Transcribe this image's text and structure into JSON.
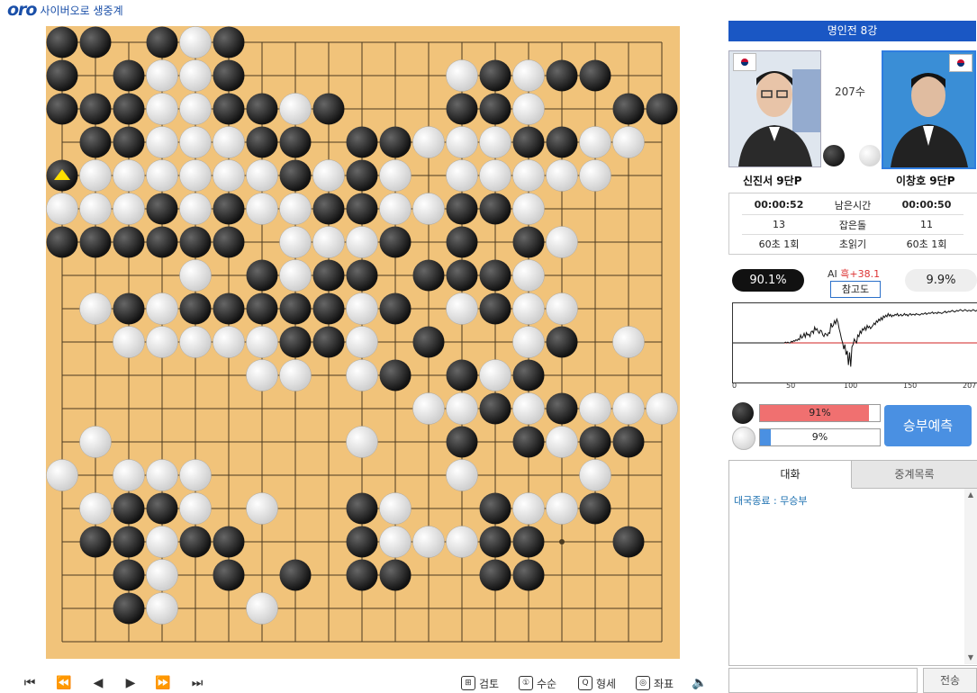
{
  "header": {
    "logo_mark": "oro",
    "logo_text": "사이버오로 생중계"
  },
  "board": {
    "size": 19,
    "colors": {
      "board": "#f1c37a",
      "line": "#4a3a20",
      "black": "#111111",
      "white": "#f4f4f4"
    },
    "rows": [
      "BB.BWB.............",
      "B.BWWB......WBWBB..",
      "BBBWWBBWB...BBW..BB",
      ".BBWWWBB.BBWWWBBWW.",
      "BWWWWWWBWBW.WWWWW..",
      "WWWBWBWWBBWWBBW....",
      "BBBBBB.WWWB.B.BW...",
      "....W.BWBB.BBBW....",
      ".WBWBBBBBWB.WBWW...",
      "..WWWWWBBW.B..WB.W.",
      "......WW.WB.BWB....",
      "...........WWBWBWWW",
      ".W.......W..B.BWBB.",
      "W.WWW.......W...W..",
      ".WBBW.W..BW..BWWB..",
      ".BBWBB...BWWWBB..B.",
      "..BW.B.B.BB..BB....",
      "..BW..W............",
      "..................."
    ],
    "last_move_marker": {
      "row": 4,
      "col": 0
    },
    "stars": [
      [
        3,
        3
      ],
      [
        3,
        9
      ],
      [
        3,
        15
      ],
      [
        9,
        3
      ],
      [
        9,
        9
      ],
      [
        9,
        15
      ],
      [
        15,
        3
      ],
      [
        15,
        9
      ],
      [
        15,
        15
      ]
    ]
  },
  "toolbar": {
    "nav": [
      "⏮",
      "⏪",
      "◀",
      "▶",
      "⏩",
      "⏭"
    ],
    "tools": [
      {
        "icon": "review-icon",
        "glyph": "⊞",
        "label": "검토"
      },
      {
        "icon": "move-order-icon",
        "glyph": "①",
        "label": "수순"
      },
      {
        "icon": "territory-icon",
        "glyph": "Q",
        "label": "형세"
      },
      {
        "icon": "coordinates-icon",
        "glyph": "◎",
        "label": "좌표"
      }
    ],
    "sound_glyph": "🔈"
  },
  "panel": {
    "title": "명인전 8강",
    "move_count": "207수",
    "black_player": {
      "name": "신진서 9단P",
      "flag": "KR"
    },
    "white_player": {
      "name": "이창호 9단P",
      "flag": "KR"
    },
    "info": {
      "rows": [
        [
          "00:00:52",
          "남은시간",
          "00:00:50"
        ],
        [
          "13",
          "잡은돌",
          "11"
        ],
        [
          "60초 1회",
          "초읽기",
          "60초 1회"
        ]
      ]
    },
    "ai": {
      "black_pct": "90.1%",
      "white_pct": "9.9%",
      "label": "AI ",
      "value": "흑+38.1",
      "ref_button": "참고도"
    },
    "graph": {
      "x_ticks": [
        "0",
        "50",
        "100",
        "150",
        "207"
      ],
      "series": [
        50,
        50,
        50,
        50,
        50,
        50,
        50,
        50,
        50,
        50,
        50,
        50,
        50,
        50,
        50,
        50,
        50,
        50,
        50,
        50,
        50,
        50,
        50,
        50,
        50,
        50,
        50,
        50,
        50,
        50,
        50,
        50,
        50,
        50,
        50,
        50,
        50,
        50,
        50,
        50,
        50,
        50,
        50,
        50,
        50,
        51,
        50,
        51,
        50,
        50,
        52,
        51,
        53,
        52,
        54,
        53,
        55,
        54,
        60,
        56,
        58,
        62,
        57,
        63,
        60,
        61,
        58,
        64,
        65,
        62,
        70,
        66,
        68,
        64,
        62,
        66,
        65,
        60,
        58,
        62,
        61,
        59,
        63,
        62,
        75,
        70,
        72,
        78,
        74,
        80,
        76,
        68,
        62,
        55,
        50,
        42,
        48,
        35,
        40,
        22,
        38,
        20,
        45,
        48,
        55,
        52,
        50,
        60,
        58,
        65,
        62,
        68,
        66,
        70,
        66,
        72,
        69,
        71,
        68,
        70,
        72,
        75,
        73,
        78,
        76,
        80,
        78,
        82,
        79,
        84,
        82,
        85,
        83,
        87,
        84,
        86,
        83,
        85,
        84,
        86,
        85,
        87,
        84,
        85,
        86,
        84,
        85,
        87,
        85,
        86,
        84,
        86,
        87,
        85,
        86,
        86,
        85,
        87,
        86,
        86,
        85,
        86,
        87,
        86,
        87,
        88,
        86,
        87,
        88,
        87,
        88,
        89,
        87,
        88,
        88,
        87,
        89,
        88,
        88,
        87,
        88,
        89,
        90,
        88,
        89,
        90,
        89,
        90,
        91,
        90,
        89,
        90,
        91,
        90,
        91,
        92,
        91,
        90,
        91,
        92,
        91,
        90,
        91,
        91,
        90,
        91,
        92,
        91,
        90,
        91,
        90
      ],
      "ylim": [
        0,
        100
      ],
      "colors": {
        "line": "#111111",
        "mid": "#d22222"
      }
    },
    "probabilities": {
      "black": {
        "label": "91%",
        "value": 91,
        "color": "#f07070"
      },
      "white": {
        "label": "9%",
        "value": 9,
        "color": "#4a90e2"
      }
    },
    "predict_button": "승부예측",
    "chat": {
      "tabs": [
        "대화",
        "중계목록"
      ],
      "messages": [
        "대국종료 : 무승부"
      ],
      "scroll_up": "▲",
      "scroll_down": "▼",
      "send": "전송"
    }
  }
}
